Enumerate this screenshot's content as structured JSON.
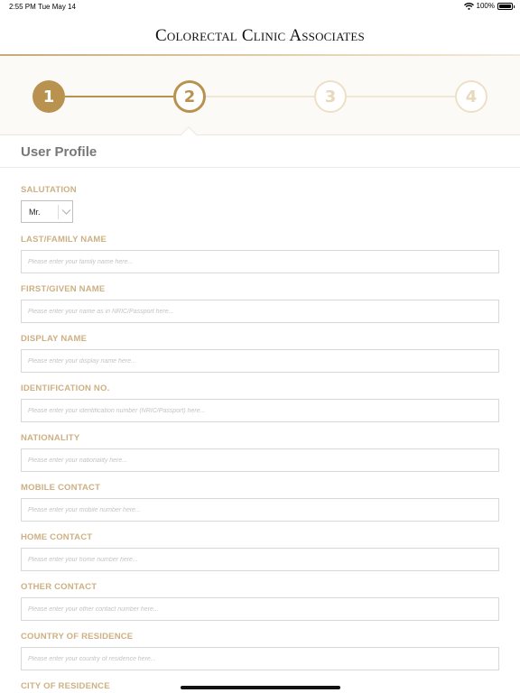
{
  "status": {
    "time": "2:55 PM",
    "date": "Tue May 14",
    "battery": "100%"
  },
  "header": {
    "brand": "Colorectal Clinic Associates"
  },
  "stepper": {
    "steps": [
      "1",
      "2",
      "3",
      "4"
    ],
    "current_step": 2
  },
  "section": {
    "title": "User Profile"
  },
  "form": {
    "salutation": {
      "label": "SALUTATION",
      "value": "Mr."
    },
    "last_name": {
      "label": "LAST/FAMILY NAME",
      "placeholder": "Please enter your family name here..."
    },
    "first_name": {
      "label": "FIRST/GIVEN NAME",
      "placeholder": "Please enter your name as in NRIC/Passport here..."
    },
    "display_name": {
      "label": "DISPLAY NAME",
      "placeholder": "Please enter your display name here..."
    },
    "identification": {
      "label": "IDENTIFICATION NO.",
      "placeholder": "Please enter your identification number (NRIC/Passport) here..."
    },
    "nationality": {
      "label": "NATIONALITY",
      "placeholder": "Please enter your nationality here..."
    },
    "mobile_contact": {
      "label": "MOBILE CONTACT",
      "placeholder": "Please enter your mobile number here..."
    },
    "home_contact": {
      "label": "HOME CONTACT",
      "placeholder": "Please enter your home number here..."
    },
    "other_contact": {
      "label": "OTHER CONTACT",
      "placeholder": "Please enter your other contact number here..."
    },
    "country_residence": {
      "label": "COUNTRY OF RESIDENCE",
      "placeholder": "Please enter your country of residence here..."
    },
    "city_residence": {
      "label": "CITY OF RESIDENCE"
    }
  },
  "colors": {
    "gold": "#b8924e",
    "label": "#cdb083",
    "pending": "#eee0c6"
  },
  "icons": {
    "wifi": "wifi-icon",
    "battery": "battery-icon",
    "chevron": "chevron-down-icon"
  }
}
